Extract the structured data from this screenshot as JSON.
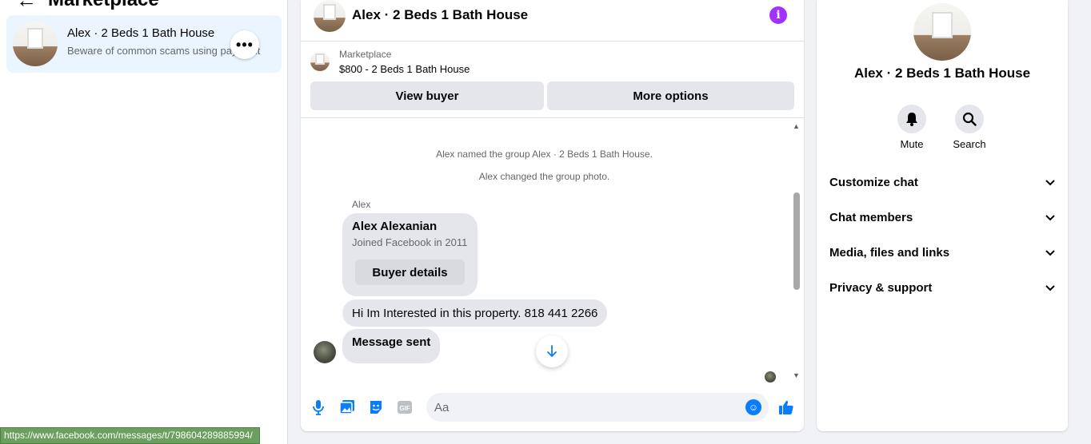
{
  "sidebar": {
    "back_icon": "arrow-left-icon",
    "title": "Marketplace",
    "conversation": {
      "name": "Alex · 2 Beds 1 Bath House",
      "snippet": "Beware of common scams using payment",
      "more_icon": "more-horizontal-icon"
    }
  },
  "status_url": "https://www.facebook.com/messages/t/798604289885994/",
  "chat": {
    "title": "Alex · 2 Beds 1 Bath House",
    "info_icon": "info-icon",
    "listing": {
      "source": "Marketplace",
      "price_title": "$800 - 2 Beds 1 Bath House",
      "view_buyer_label": "View buyer",
      "more_options_label": "More options"
    },
    "messages": {
      "system_1": "Alex named the group Alex · 2 Beds 1 Bath House.",
      "system_2": "Alex changed the group photo.",
      "sender": "Alex",
      "card_name": "Alex Alexanian",
      "card_sub": "Joined Facebook in 2011",
      "card_button": "Buyer details",
      "message_1": "Hi Im Interested in this property. 818 441 2266",
      "message_2": "Message sent"
    },
    "composer": {
      "placeholder": "Aa"
    }
  },
  "details": {
    "name": "Alex · 2 Beds 1 Bath House",
    "mute_label": "Mute",
    "search_label": "Search",
    "sections": [
      "Customize chat",
      "Chat members",
      "Media, files and links",
      "Privacy & support"
    ]
  },
  "colors": {
    "accent": "#0a7cff",
    "info": "#a033ff",
    "selected_bg": "#ebf5ff",
    "statusbar": "#6a9f5e"
  }
}
